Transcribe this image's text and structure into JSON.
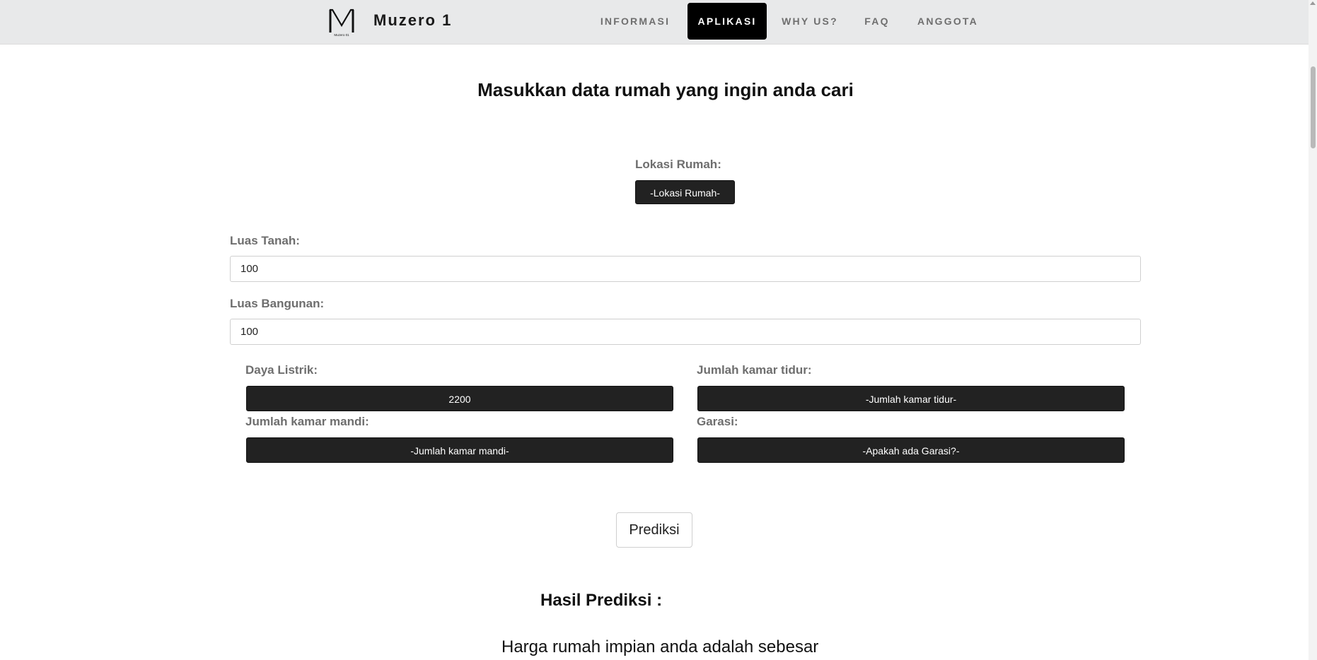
{
  "navbar": {
    "brand_name": "Muzero 1",
    "logo_caption": "Muzero 01",
    "items": [
      {
        "label": "INFORMASI",
        "active": false
      },
      {
        "label": "APLIKASI",
        "active": true
      },
      {
        "label": "WHY US?",
        "active": false
      },
      {
        "label": "FAQ",
        "active": false
      },
      {
        "label": "ANGGOTA",
        "active": false
      }
    ]
  },
  "form": {
    "title": "Masukkan data rumah yang ingin anda cari",
    "lokasi": {
      "label": "Lokasi Rumah:",
      "value": "-Lokasi Rumah-"
    },
    "luas_tanah": {
      "label": "Luas Tanah:",
      "value": "100"
    },
    "luas_bangunan": {
      "label": "Luas Bangunan:",
      "value": "100"
    },
    "daya_listrik": {
      "label": "Daya Listrik:",
      "value": "2200"
    },
    "kamar_tidur": {
      "label": "Jumlah kamar tidur:",
      "value": "-Jumlah kamar tidur-"
    },
    "kamar_mandi": {
      "label": "Jumlah kamar mandi:",
      "value": "-Jumlah kamar mandi-"
    },
    "garasi": {
      "label": "Garasi:",
      "value": "-Apakah ada Garasi?-"
    },
    "predict_label": "Prediksi"
  },
  "result": {
    "title": "Hasil Prediksi :",
    "text": "Harga rumah impian anda adalah sebesar"
  },
  "colors": {
    "navbar_bg": "#e8e9ea",
    "active_nav_bg": "#000000",
    "dark_select_bg": "#222222"
  }
}
